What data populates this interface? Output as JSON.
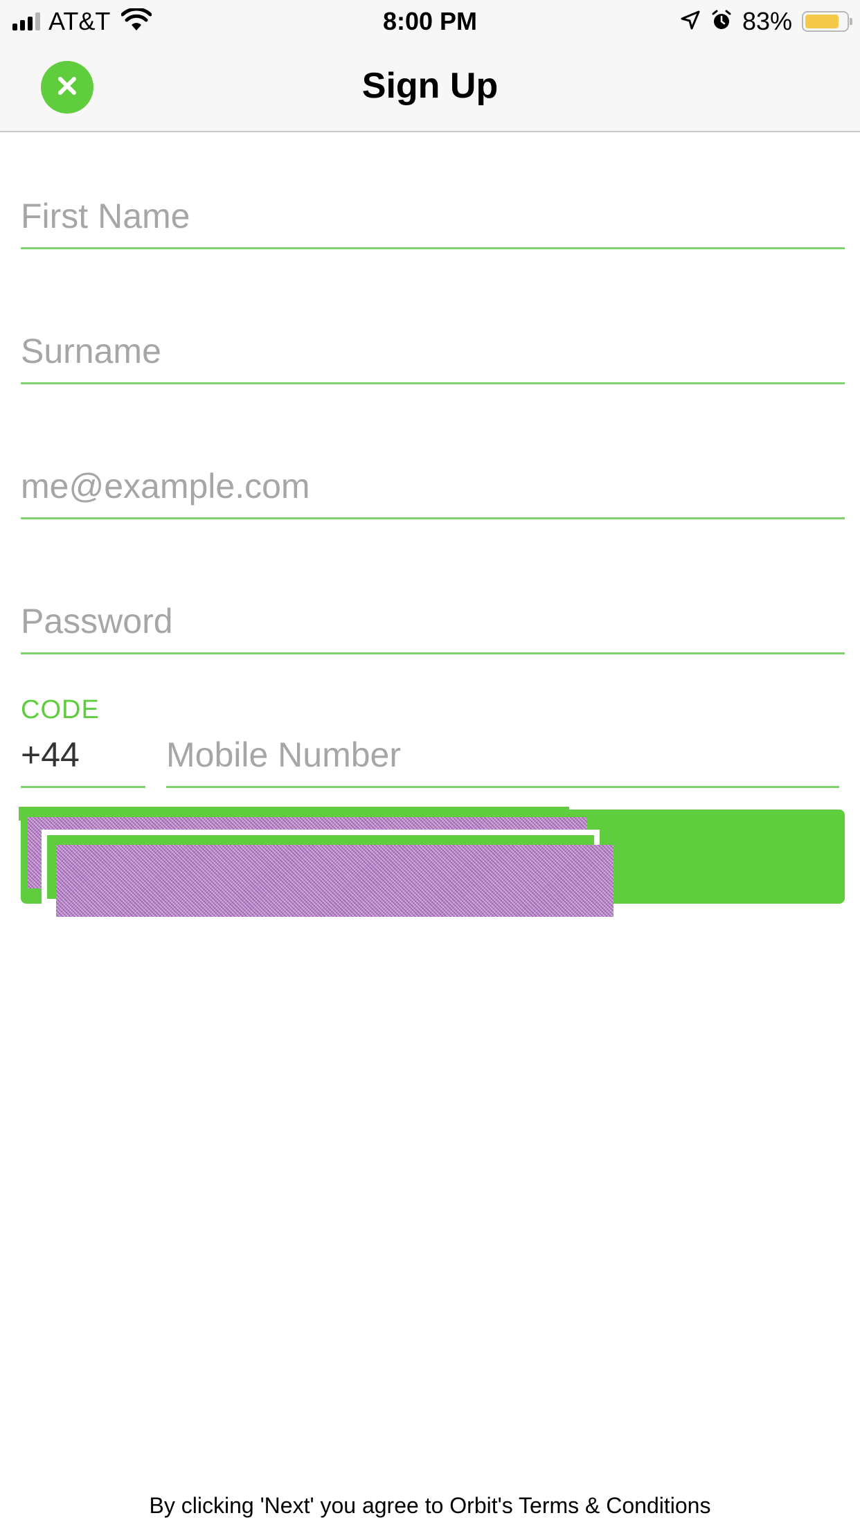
{
  "status_bar": {
    "carrier": "AT&T",
    "time": "8:00 PM",
    "battery_percent": "83%",
    "battery_level": 0.83,
    "signal_bars": 3,
    "signal_bars_max": 4,
    "icons": [
      "signal-icon",
      "wifi-icon",
      "location-arrow-icon",
      "alarm-icon",
      "battery-icon"
    ]
  },
  "nav": {
    "title": "Sign Up",
    "close_icon": "close-icon"
  },
  "form": {
    "first_name": {
      "placeholder": "First Name",
      "value": ""
    },
    "surname": {
      "placeholder": "Surname",
      "value": ""
    },
    "email": {
      "placeholder": "me@example.com",
      "value": ""
    },
    "password": {
      "placeholder": "Password",
      "value": ""
    },
    "code_label": "CODE",
    "code_value": "+44",
    "mobile": {
      "placeholder": "Mobile Number",
      "value": ""
    }
  },
  "footer": {
    "terms": "By clicking 'Next' you agree to Orbit's Terms & Conditions"
  },
  "colors": {
    "accent": "#5fcd3e",
    "underline": "#7ed46a",
    "placeholder": "#a6a6a6",
    "battery": "#f5c94a"
  }
}
